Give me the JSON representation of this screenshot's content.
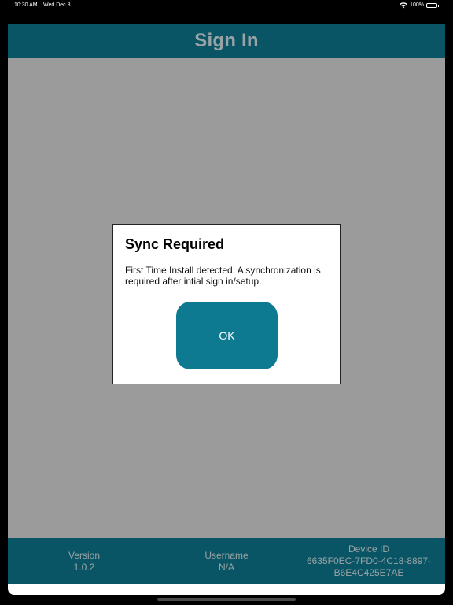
{
  "status_bar": {
    "time": "10:30 AM",
    "date": "Wed Dec 8",
    "battery": "100%",
    "wifi_icon": "wifi-icon",
    "battery_icon": "battery-full-icon"
  },
  "header": {
    "title": "Sign In"
  },
  "dialog": {
    "title": "Sync Required",
    "message": "First Time Install detected. A synchronization is required after intial sign in/setup.",
    "ok_label": "OK"
  },
  "footer": {
    "version_label": "Version",
    "version_value": "1.0.2",
    "username_label": "Username",
    "username_value": "N/A",
    "device_label": "Device ID",
    "device_value_line1": "6635F0EC-7FD0-4C18-8897-",
    "device_value_line2": "B6E4C425E7AE"
  },
  "colors": {
    "header_bg": "#0a5565",
    "overlay_gray": "#9b9b9b",
    "ok_button": "#0e7a92",
    "muted_text": "#9aa3a6"
  }
}
